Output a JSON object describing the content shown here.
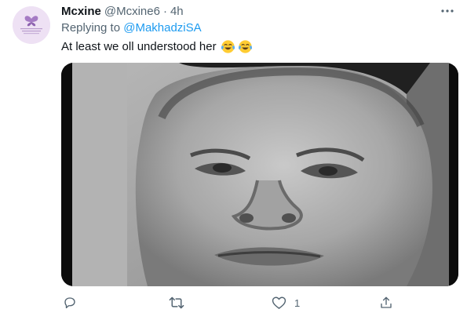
{
  "tweet": {
    "display_name": "Mcxine",
    "handle": "@Mcxine6",
    "separator": "·",
    "time": "4h",
    "replying_prefix": "Replying to",
    "replying_handle": "@MakhadziSA",
    "text": "At least we oll understood her",
    "emojis": [
      "face-with-tears-of-joy",
      "face-with-tears-of-joy"
    ],
    "media": {
      "type": "image",
      "subject": "close-up-face-meme"
    },
    "actions": {
      "reply_count": "",
      "retweet_count": "",
      "like_count": "1"
    }
  },
  "colors": {
    "text": "#0f1419",
    "secondary": "#536471",
    "link": "#1d9bf0",
    "avatar_bg": "#eee1f4"
  },
  "icons": [
    "avatar-butterfly-icon",
    "more-icon",
    "reply-icon",
    "retweet-icon",
    "like-icon",
    "share-icon"
  ]
}
